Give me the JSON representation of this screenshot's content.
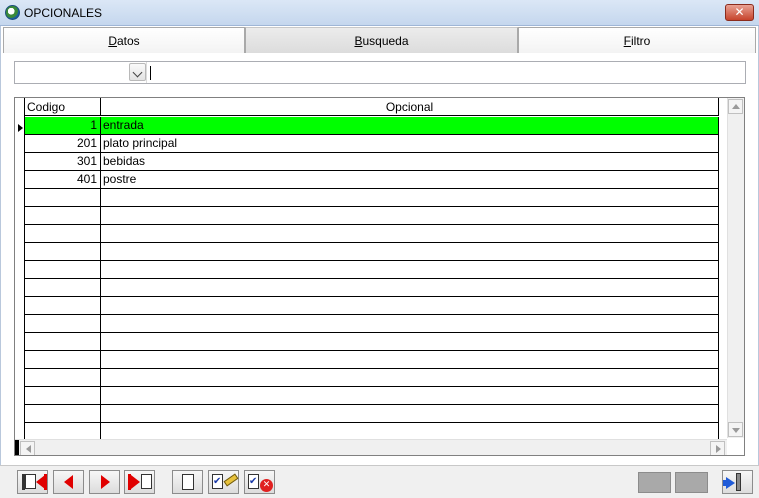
{
  "window": {
    "title": "OPCIONALES",
    "close_label": "✕"
  },
  "tabs": [
    {
      "label": "Datos",
      "accel": "D",
      "rest": "atos"
    },
    {
      "label": "Busqueda",
      "accel": "B",
      "rest": "usqueda"
    },
    {
      "label": "Filtro",
      "accel": "F",
      "rest": "iltro"
    }
  ],
  "active_tab": "Busqueda",
  "search": {
    "field_value": "",
    "text_value": ""
  },
  "grid": {
    "columns": [
      "Codigo",
      "Opcional"
    ],
    "rows": [
      {
        "codigo": "1",
        "opcional": "entrada"
      },
      {
        "codigo": "201",
        "opcional": "plato principal"
      },
      {
        "codigo": "301",
        "opcional": "bebidas"
      },
      {
        "codigo": "401",
        "opcional": "postre"
      }
    ],
    "selected_row_index": 0,
    "selected_color": "#00ff00",
    "empty_rows": 14
  },
  "toolbar": {
    "buttons": [
      "first-record",
      "previous-record",
      "next-record",
      "last-record",
      "new-record",
      "edit-record",
      "delete-record",
      "save",
      "cancel",
      "exit"
    ]
  }
}
